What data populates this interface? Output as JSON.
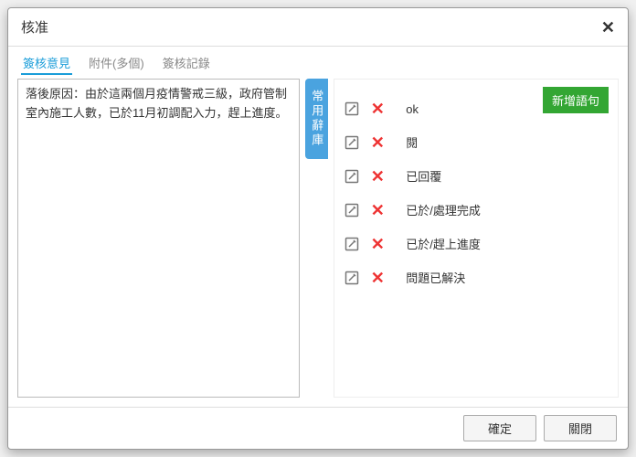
{
  "modal": {
    "title": "核准",
    "tabs": [
      {
        "label": "簽核意見",
        "active": true
      },
      {
        "label": "附件(多個)",
        "active": false
      },
      {
        "label": "簽核記錄",
        "active": false
      }
    ],
    "textarea_value": "落後原因：由於這兩個月疫情警戒三級，政府管制室內施工人數，已於11月初調配入力，趕上進度。",
    "vtab_label": "常用辭庫",
    "add_phrase_label": "新增語句",
    "phrases": [
      {
        "text": "ok"
      },
      {
        "text": "閱"
      },
      {
        "text": "已回覆"
      },
      {
        "text": "已於/處理完成"
      },
      {
        "text": "已於/趕上進度"
      },
      {
        "text": "問題已解決"
      }
    ],
    "footer": {
      "confirm": "確定",
      "close": "關閉"
    }
  }
}
